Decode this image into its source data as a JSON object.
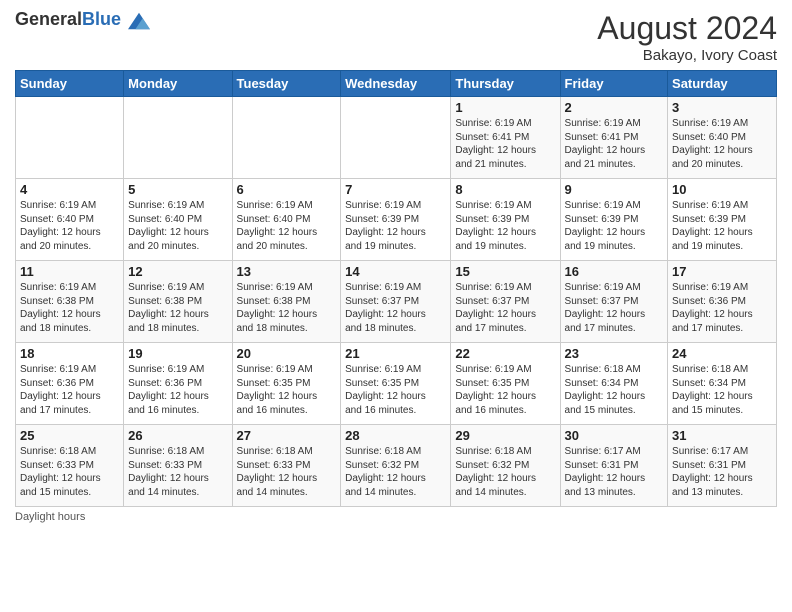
{
  "header": {
    "logo_general": "General",
    "logo_blue": "Blue",
    "title": "August 2024",
    "subtitle": "Bakayo, Ivory Coast"
  },
  "days_of_week": [
    "Sunday",
    "Monday",
    "Tuesday",
    "Wednesday",
    "Thursday",
    "Friday",
    "Saturday"
  ],
  "footer": {
    "daylight_hours": "Daylight hours"
  },
  "weeks": [
    {
      "days": [
        {
          "num": "",
          "info": ""
        },
        {
          "num": "",
          "info": ""
        },
        {
          "num": "",
          "info": ""
        },
        {
          "num": "",
          "info": ""
        },
        {
          "num": "1",
          "info": "Sunrise: 6:19 AM\nSunset: 6:41 PM\nDaylight: 12 hours\nand 21 minutes."
        },
        {
          "num": "2",
          "info": "Sunrise: 6:19 AM\nSunset: 6:41 PM\nDaylight: 12 hours\nand 21 minutes."
        },
        {
          "num": "3",
          "info": "Sunrise: 6:19 AM\nSunset: 6:40 PM\nDaylight: 12 hours\nand 20 minutes."
        }
      ]
    },
    {
      "days": [
        {
          "num": "4",
          "info": "Sunrise: 6:19 AM\nSunset: 6:40 PM\nDaylight: 12 hours\nand 20 minutes."
        },
        {
          "num": "5",
          "info": "Sunrise: 6:19 AM\nSunset: 6:40 PM\nDaylight: 12 hours\nand 20 minutes."
        },
        {
          "num": "6",
          "info": "Sunrise: 6:19 AM\nSunset: 6:40 PM\nDaylight: 12 hours\nand 20 minutes."
        },
        {
          "num": "7",
          "info": "Sunrise: 6:19 AM\nSunset: 6:39 PM\nDaylight: 12 hours\nand 19 minutes."
        },
        {
          "num": "8",
          "info": "Sunrise: 6:19 AM\nSunset: 6:39 PM\nDaylight: 12 hours\nand 19 minutes."
        },
        {
          "num": "9",
          "info": "Sunrise: 6:19 AM\nSunset: 6:39 PM\nDaylight: 12 hours\nand 19 minutes."
        },
        {
          "num": "10",
          "info": "Sunrise: 6:19 AM\nSunset: 6:39 PM\nDaylight: 12 hours\nand 19 minutes."
        }
      ]
    },
    {
      "days": [
        {
          "num": "11",
          "info": "Sunrise: 6:19 AM\nSunset: 6:38 PM\nDaylight: 12 hours\nand 18 minutes."
        },
        {
          "num": "12",
          "info": "Sunrise: 6:19 AM\nSunset: 6:38 PM\nDaylight: 12 hours\nand 18 minutes."
        },
        {
          "num": "13",
          "info": "Sunrise: 6:19 AM\nSunset: 6:38 PM\nDaylight: 12 hours\nand 18 minutes."
        },
        {
          "num": "14",
          "info": "Sunrise: 6:19 AM\nSunset: 6:37 PM\nDaylight: 12 hours\nand 18 minutes."
        },
        {
          "num": "15",
          "info": "Sunrise: 6:19 AM\nSunset: 6:37 PM\nDaylight: 12 hours\nand 17 minutes."
        },
        {
          "num": "16",
          "info": "Sunrise: 6:19 AM\nSunset: 6:37 PM\nDaylight: 12 hours\nand 17 minutes."
        },
        {
          "num": "17",
          "info": "Sunrise: 6:19 AM\nSunset: 6:36 PM\nDaylight: 12 hours\nand 17 minutes."
        }
      ]
    },
    {
      "days": [
        {
          "num": "18",
          "info": "Sunrise: 6:19 AM\nSunset: 6:36 PM\nDaylight: 12 hours\nand 17 minutes."
        },
        {
          "num": "19",
          "info": "Sunrise: 6:19 AM\nSunset: 6:36 PM\nDaylight: 12 hours\nand 16 minutes."
        },
        {
          "num": "20",
          "info": "Sunrise: 6:19 AM\nSunset: 6:35 PM\nDaylight: 12 hours\nand 16 minutes."
        },
        {
          "num": "21",
          "info": "Sunrise: 6:19 AM\nSunset: 6:35 PM\nDaylight: 12 hours\nand 16 minutes."
        },
        {
          "num": "22",
          "info": "Sunrise: 6:19 AM\nSunset: 6:35 PM\nDaylight: 12 hours\nand 16 minutes."
        },
        {
          "num": "23",
          "info": "Sunrise: 6:18 AM\nSunset: 6:34 PM\nDaylight: 12 hours\nand 15 minutes."
        },
        {
          "num": "24",
          "info": "Sunrise: 6:18 AM\nSunset: 6:34 PM\nDaylight: 12 hours\nand 15 minutes."
        }
      ]
    },
    {
      "days": [
        {
          "num": "25",
          "info": "Sunrise: 6:18 AM\nSunset: 6:33 PM\nDaylight: 12 hours\nand 15 minutes."
        },
        {
          "num": "26",
          "info": "Sunrise: 6:18 AM\nSunset: 6:33 PM\nDaylight: 12 hours\nand 14 minutes."
        },
        {
          "num": "27",
          "info": "Sunrise: 6:18 AM\nSunset: 6:33 PM\nDaylight: 12 hours\nand 14 minutes."
        },
        {
          "num": "28",
          "info": "Sunrise: 6:18 AM\nSunset: 6:32 PM\nDaylight: 12 hours\nand 14 minutes."
        },
        {
          "num": "29",
          "info": "Sunrise: 6:18 AM\nSunset: 6:32 PM\nDaylight: 12 hours\nand 14 minutes."
        },
        {
          "num": "30",
          "info": "Sunrise: 6:17 AM\nSunset: 6:31 PM\nDaylight: 12 hours\nand 13 minutes."
        },
        {
          "num": "31",
          "info": "Sunrise: 6:17 AM\nSunset: 6:31 PM\nDaylight: 12 hours\nand 13 minutes."
        }
      ]
    }
  ]
}
